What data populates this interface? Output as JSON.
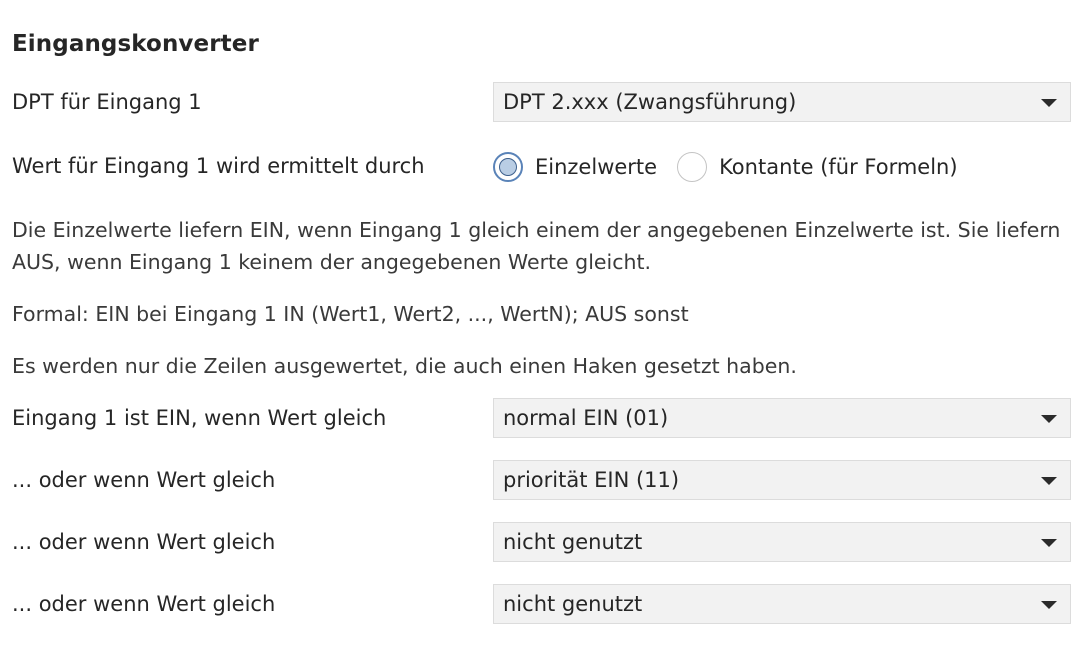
{
  "section": {
    "title": "Eingangskonverter"
  },
  "dpt": {
    "label": "DPT für Eingang 1",
    "value": "DPT 2.xxx (Zwangsführung)"
  },
  "mode": {
    "label": "Wert für Eingang 1 wird ermittelt durch",
    "options": [
      {
        "label": "Einzelwerte",
        "checked": true
      },
      {
        "label": "Kontante (für Formeln)",
        "checked": false
      }
    ]
  },
  "info": {
    "description": "Die Einzelwerte liefern EIN, wenn Eingang 1 gleich einem der angegebenen Einzelwerte ist. Sie liefern AUS, wenn Eingang 1 keinem der angegebenen Werte gleicht.",
    "formal": "Formal: EIN bei Eingang 1 IN (Wert1, Wert2, ..., WertN); AUS sonst",
    "note": "Es werden nur die Zeilen ausgewertet, die auch einen Haken gesetzt haben."
  },
  "conditions": [
    {
      "label": "Eingang 1 ist EIN, wenn Wert gleich",
      "value": "normal EIN (01)"
    },
    {
      "label": "... oder wenn Wert gleich",
      "value": "priorität EIN (11)"
    },
    {
      "label": "... oder wenn Wert gleich",
      "value": "nicht genutzt"
    },
    {
      "label": "... oder wenn Wert gleich",
      "value": "nicht genutzt"
    }
  ],
  "colors": {
    "select_background": "#f2f2f2",
    "radio_accent": "#5a83b8",
    "text": "#262626"
  }
}
